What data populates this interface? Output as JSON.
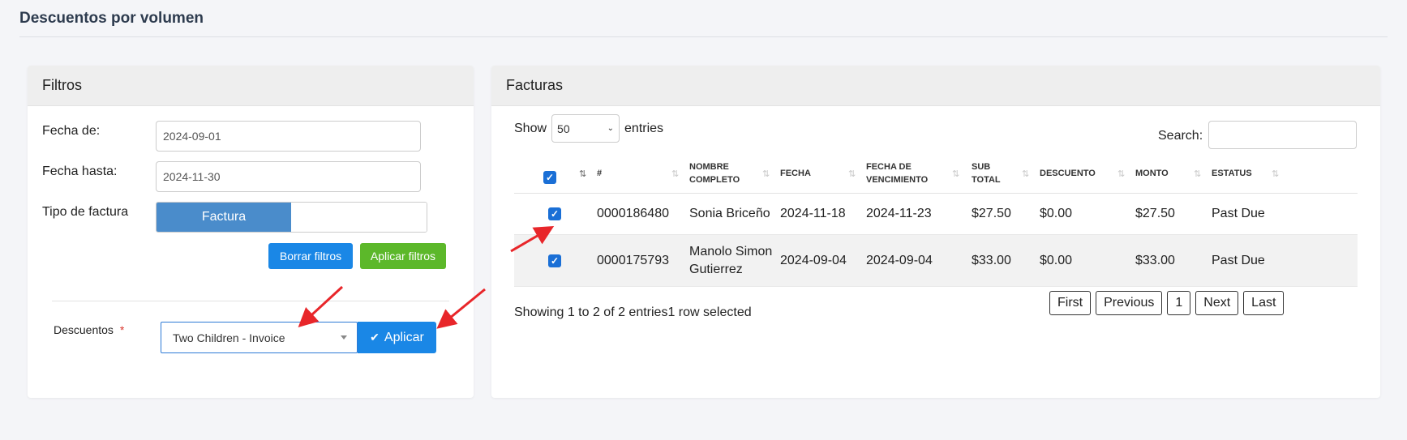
{
  "page": {
    "title": "Descuentos por volumen"
  },
  "filters": {
    "header": "Filtros",
    "fecha_de_label": "Fecha de:",
    "fecha_de_value": "2024-09-01",
    "fecha_hasta_label": "Fecha hasta:",
    "fecha_hasta_value": "2024-11-30",
    "tipo_label": "Tipo de factura",
    "tipo_selected": "Factura",
    "clear_button": "Borrar filtros",
    "apply_button": "Aplicar filtros",
    "descuentos_label": "Descuentos",
    "required_mark": "*",
    "descuentos_selected": "Two Children - Invoice",
    "aplicar_button": "Aplicar"
  },
  "invoices": {
    "header": "Facturas",
    "show_label": "Show",
    "entries_value": "50",
    "entries_label": "entries",
    "search_label": "Search:",
    "columns": [
      "#",
      "NOMBRE\nCOMPLETO",
      "FECHA",
      "FECHA DE\nVENCIMIENTO",
      "SUB\nTOTAL",
      "DESCUENTO",
      "MONTO",
      "ESTATUS"
    ],
    "rows": [
      {
        "id": "0000186480",
        "name": "Sonia Briceño",
        "fecha": "2024-11-18",
        "venc": "2024-11-23",
        "subtotal": "$27.50",
        "descuento": "$0.00",
        "monto": "$27.50",
        "estatus": "Past Due"
      },
      {
        "id": "0000175793",
        "name": "Manolo Simon\nGutierrez",
        "fecha": "2024-09-04",
        "venc": "2024-09-04",
        "subtotal": "$33.00",
        "descuento": "$0.00",
        "monto": "$33.00",
        "estatus": "Past Due"
      }
    ],
    "info": "Showing 1 to 2 of 2 entries1 row selected",
    "pager": {
      "first": "First",
      "previous": "Previous",
      "page": "1",
      "next": "Next",
      "last": "Last"
    }
  },
  "colors": {
    "primary": "#1a87e6",
    "success": "#5cb82a",
    "toggle": "#4a8ccb",
    "annotation": "#e8262a"
  },
  "icons": {
    "check": "check-icon",
    "caret": "caret-down-icon",
    "sort": "sort-icon"
  }
}
